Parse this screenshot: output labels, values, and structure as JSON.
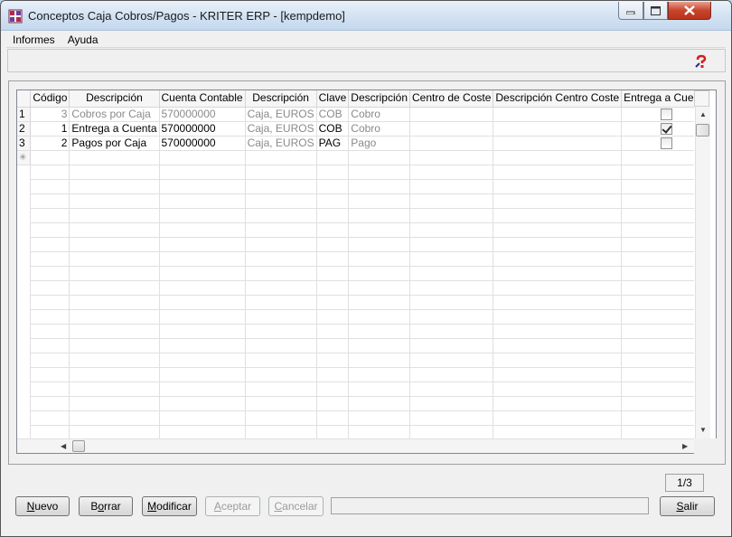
{
  "window": {
    "title": "Conceptos Caja Cobros/Pagos - KRITER ERP - [kempdemo]"
  },
  "menu": [
    "Informes",
    "Ayuda"
  ],
  "grid": {
    "columns": [
      "",
      "Código",
      "Descripción",
      "Cuenta Contable",
      "Descripción",
      "Clave",
      "Descripción",
      "Centro de Coste",
      "Descripción Centro Coste",
      "Entrega a Cuenta"
    ],
    "rows": [
      {
        "num": "1",
        "codigo": "3",
        "descripcion": "Cobros por Caja",
        "cuenta": "570000000",
        "desc_cuenta": "Caja, EUROS",
        "clave": "COB",
        "desc_clave": "Cobro",
        "centro": "",
        "desc_centro": "",
        "entrega": false,
        "selected": true
      },
      {
        "num": "2",
        "codigo": "1",
        "descripcion": "Entrega a Cuenta",
        "cuenta": "570000000",
        "desc_cuenta": "Caja, EUROS",
        "clave": "COB",
        "desc_clave": "Cobro",
        "centro": "",
        "desc_centro": "",
        "entrega": true,
        "selected": false
      },
      {
        "num": "3",
        "codigo": "2",
        "descripcion": "Pagos por Caja",
        "cuenta": "570000000",
        "desc_cuenta": "Caja, EUROS",
        "clave": "PAG",
        "desc_clave": "Pago",
        "centro": "",
        "desc_centro": "",
        "entrega": false,
        "selected": false
      }
    ],
    "new_row_marker": "✳"
  },
  "pager": "1/3",
  "buttons": {
    "nuevo": "Nuevo",
    "borrar": "Borrar",
    "modificar": "Modificar",
    "aceptar": "Aceptar",
    "cancelar": "Cancelar",
    "salir": "Salir"
  },
  "colors": {
    "accent_close": "#c8442c",
    "help_icon": "#d42020"
  },
  "icons": [
    "app-icon",
    "help-icon",
    "minimize-icon",
    "maximize-icon",
    "close-icon",
    "row-pointer-icon"
  ]
}
